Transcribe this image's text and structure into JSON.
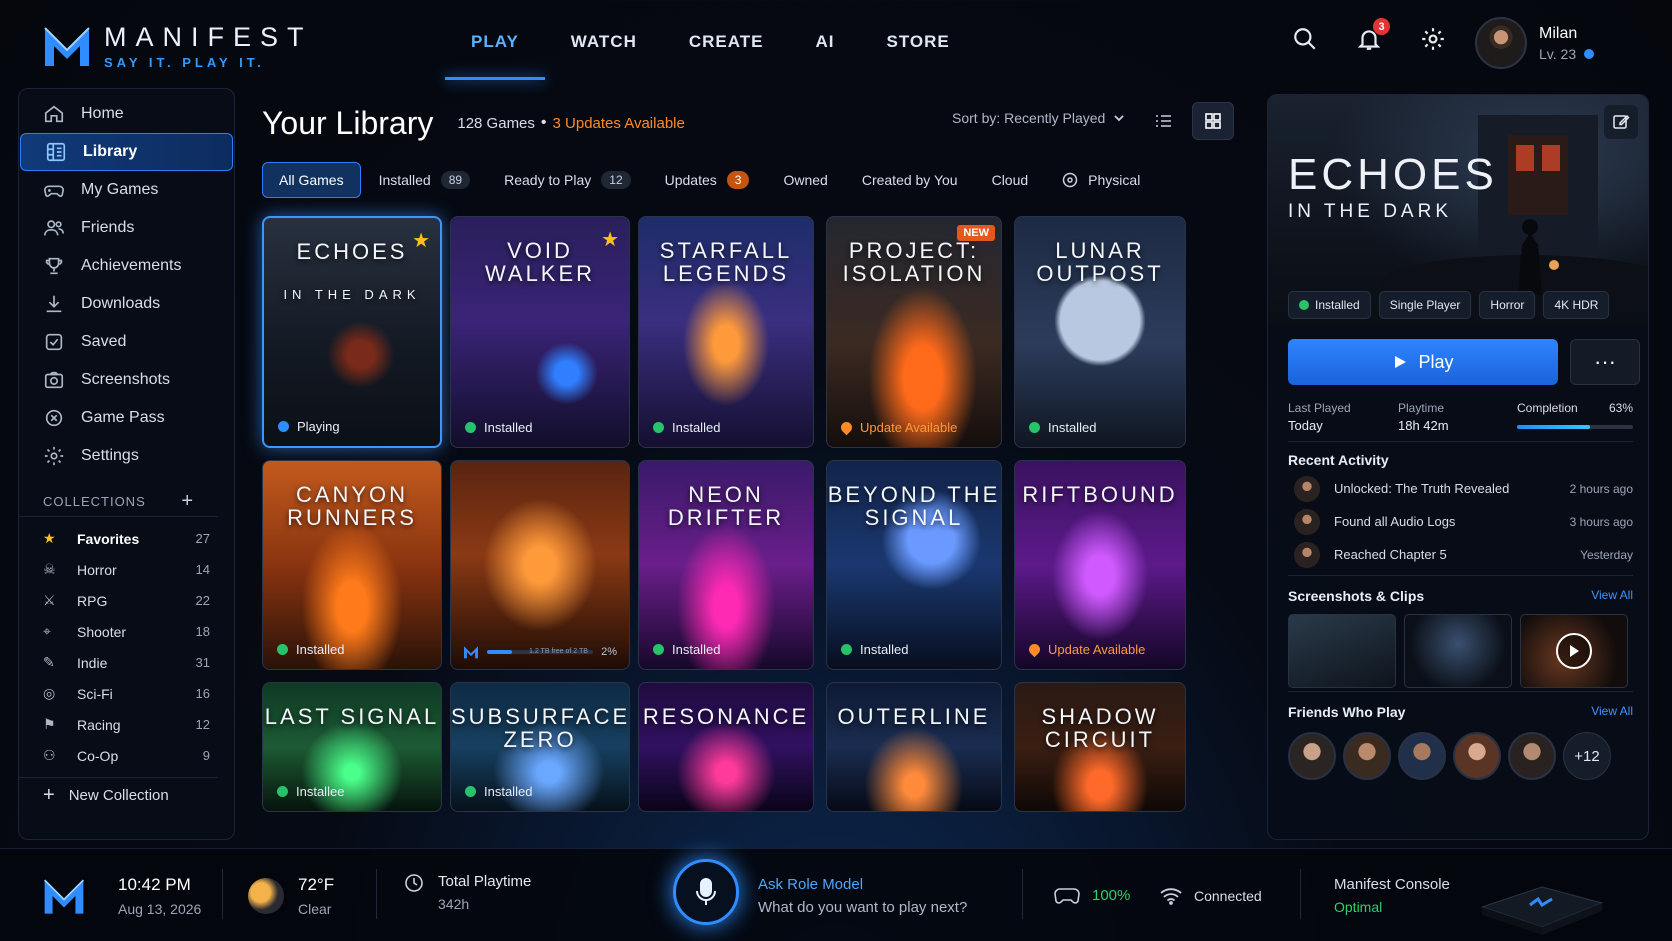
{
  "brand": {
    "name": "MANIFEST",
    "tagline": "SAY IT. PLAY IT."
  },
  "nav": [
    {
      "label": "PLAY",
      "active": true
    },
    {
      "label": "WATCH"
    },
    {
      "label": "CREATE"
    },
    {
      "label": "AI"
    },
    {
      "label": "STORE"
    }
  ],
  "notifications": {
    "count": "3"
  },
  "profile": {
    "name": "Milan",
    "level": "Lv. 23"
  },
  "sidebar": {
    "items": [
      {
        "label": "Home",
        "icon": "home-icon"
      },
      {
        "label": "Library",
        "icon": "library-icon",
        "active": true
      },
      {
        "label": "My Games",
        "icon": "gamepad-icon"
      },
      {
        "label": "Friends",
        "icon": "friends-icon"
      },
      {
        "label": "Achievements",
        "icon": "trophy-icon"
      },
      {
        "label": "Downloads",
        "icon": "download-icon"
      },
      {
        "label": "Saved",
        "icon": "saved-icon"
      },
      {
        "label": "Screenshots",
        "icon": "camera-icon"
      },
      {
        "label": "Game Pass",
        "icon": "pass-icon"
      },
      {
        "label": "Settings",
        "icon": "gear-icon"
      }
    ],
    "collections_label": "COLLECTIONS",
    "collections": [
      {
        "label": "Favorites",
        "count": "27",
        "icon": "star-icon"
      },
      {
        "label": "Horror",
        "count": "14",
        "icon": "skull-icon"
      },
      {
        "label": "RPG",
        "count": "22",
        "icon": "sword-icon"
      },
      {
        "label": "Shooter",
        "count": "18",
        "icon": "crosshair-icon"
      },
      {
        "label": "Indie",
        "count": "31",
        "icon": "feather-icon"
      },
      {
        "label": "Sci-Fi",
        "count": "16",
        "icon": "planet-icon"
      },
      {
        "label": "Racing",
        "count": "12",
        "icon": "flag-icon"
      },
      {
        "label": "Co-Op",
        "count": "9",
        "icon": "coop-icon"
      }
    ],
    "new_collection": "New Collection"
  },
  "library": {
    "title": "Your Library",
    "count": "128 Games",
    "updates": "3 Updates Available",
    "sort": "Sort by:  Recently Played",
    "filters": [
      {
        "label": "All Games",
        "active": true
      },
      {
        "label": "Installed",
        "count": "89"
      },
      {
        "label": "Ready to Play",
        "count": "12"
      },
      {
        "label": "Updates",
        "count": "3",
        "warn": true
      },
      {
        "label": "Owned"
      },
      {
        "label": "Created by You"
      },
      {
        "label": "Cloud"
      },
      {
        "label": "Physical",
        "icon": "disc-icon"
      }
    ],
    "games": [
      {
        "title": "ECHOES",
        "sub": "IN THE DARK",
        "status": "Playing",
        "kind": "play",
        "star": true,
        "selected": true
      },
      {
        "title": "VOID WALKER",
        "status": "Installed",
        "kind": "ok",
        "star": true
      },
      {
        "title": "STARFALL LEGENDS",
        "status": "Installed",
        "kind": "ok"
      },
      {
        "title": "PROJECT: ISOLATION",
        "status": "Update Available",
        "kind": "upd",
        "badge": "NEW"
      },
      {
        "title": "LUNAR OUTPOST",
        "status": "Installed",
        "kind": "ok"
      },
      {
        "title": "CANYON RUNNERS",
        "status": "Installed",
        "kind": "ok"
      },
      {
        "title": "",
        "kind": "dl",
        "progress": "2%",
        "progress_value": 0.02,
        "note": "1.2 TB free of 2 TB"
      },
      {
        "title": "NEON DRIFTER",
        "status": "Installed",
        "kind": "ok"
      },
      {
        "title": "BEYOND THE SIGNAL",
        "status": "Installed",
        "kind": "ok"
      },
      {
        "title": "RIFTBOUND",
        "status": "Update Available",
        "kind": "upd"
      },
      {
        "title": "LAST SIGNAL",
        "status": "Installee",
        "kind": "ok"
      },
      {
        "title": "SUBSURFACE ZERO",
        "status": "Installed",
        "kind": "ok"
      },
      {
        "title": "RESONANCE",
        "status": "",
        "kind": "none"
      },
      {
        "title": "OUTERLINE",
        "status": "",
        "kind": "none"
      },
      {
        "title": "SHADOW CIRCUIT",
        "status": "",
        "kind": "none"
      }
    ]
  },
  "detail": {
    "title": "ECHOES",
    "subtitle": "IN THE DARK",
    "tags": [
      "Installed",
      "Single Player",
      "Horror",
      "4K HDR"
    ],
    "play": "Play",
    "more": "···",
    "last_played_label": "Last Played",
    "last_played": "Today",
    "playtime_label": "Playtime",
    "playtime": "18h 42m",
    "completion_label": "Completion",
    "completion": "63%",
    "completion_value": 0.63,
    "recent_label": "Recent Activity",
    "activity": [
      {
        "text": "Unlocked: The Truth Revealed",
        "time": "2 hours ago"
      },
      {
        "text": "Found all Audio Logs",
        "time": "3 hours ago"
      },
      {
        "text": "Reached Chapter 5",
        "time": "Yesterday"
      }
    ],
    "shots_label": "Screenshots & Clips",
    "friends_label": "Friends Who Play",
    "view_all": "View All",
    "friends_more": "+12"
  },
  "bottom": {
    "time": "10:42 PM",
    "date": "Aug 13, 2026",
    "temp": "72°F",
    "weather": "Clear",
    "playtime_label": "Total Playtime",
    "playtime": "342h",
    "ask_title": "Ask Role Model",
    "ask_sub": "What do you want to play next?",
    "battery": "100%",
    "network": "Connected",
    "console_label": "Manifest Console",
    "console_status": "Optimal"
  },
  "colors": {
    "accent": "#2f8dff",
    "warning": "#ff8a2a",
    "success": "#27c26a"
  }
}
